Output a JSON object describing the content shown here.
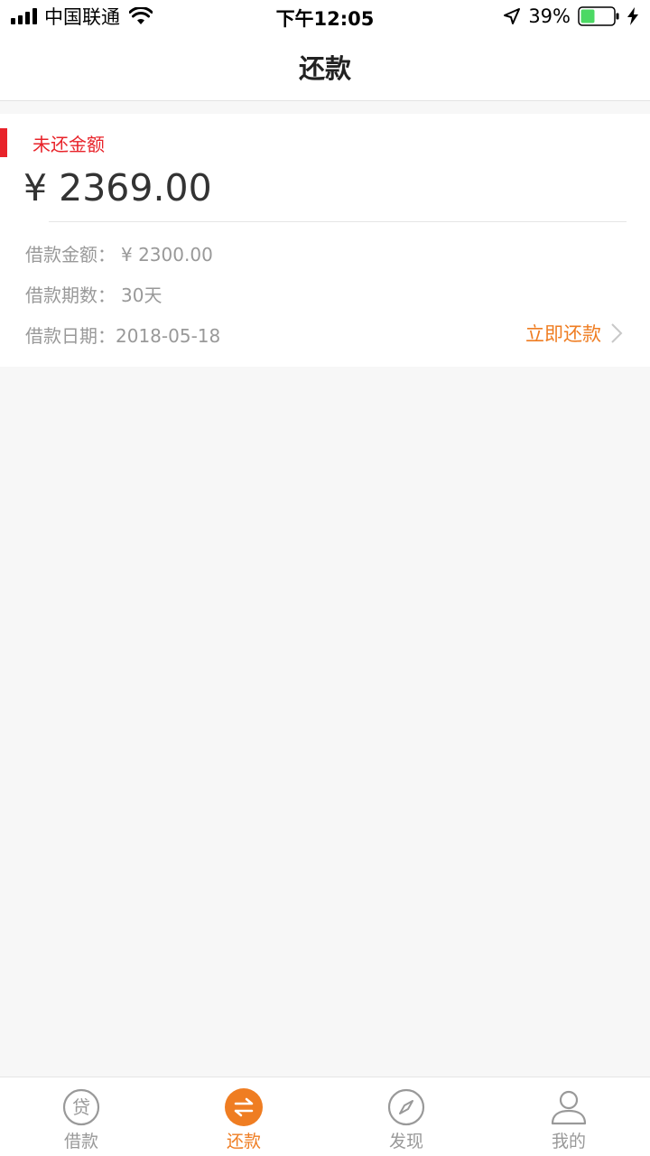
{
  "status_bar": {
    "carrier": "中国联通",
    "time": "下午12:05",
    "battery": "39%"
  },
  "nav": {
    "title": "还款"
  },
  "card": {
    "label": "未还金额",
    "amount": "¥ 2369.00",
    "loan_amount_label": "借款金额：",
    "loan_amount_value": "¥ 2300.00",
    "loan_term_label": "借款期数：",
    "loan_term_value": "30天",
    "loan_date_label": "借款日期：",
    "loan_date_value": "2018-05-18",
    "repay_button": "立即还款"
  },
  "tabs": [
    {
      "label": "借款",
      "icon": "loan-icon",
      "active": false
    },
    {
      "label": "还款",
      "icon": "repay-icon",
      "active": true
    },
    {
      "label": "发现",
      "icon": "compass-icon",
      "active": false
    },
    {
      "label": "我的",
      "icon": "user-icon",
      "active": false
    }
  ],
  "colors": {
    "accent": "#ef7d22",
    "alert": "#e8232a",
    "muted": "#999999"
  }
}
